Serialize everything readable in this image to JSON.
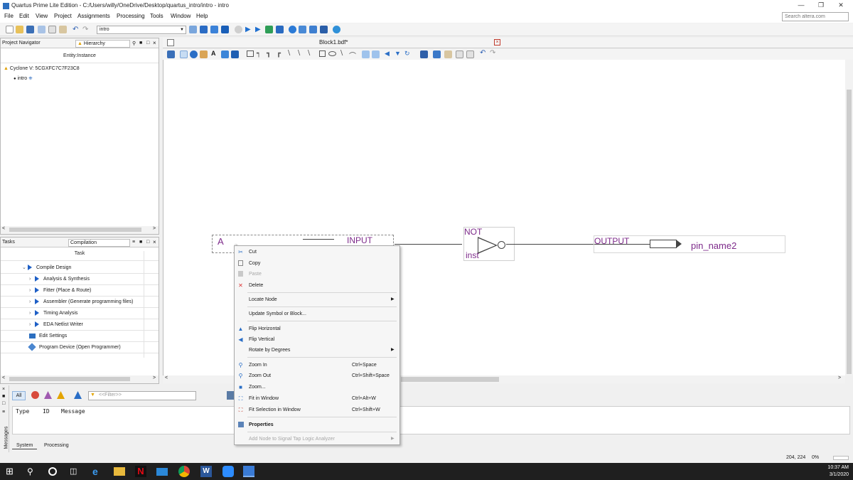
{
  "window": {
    "title": "Quartus Prime Lite Edition - C:/Users/willy/OneDrive/Desktop/quartus_intro/intro - intro",
    "controls": [
      "minimize",
      "restore",
      "close"
    ]
  },
  "menu_bar": [
    "File",
    "Edit",
    "View",
    "Project",
    "Assignments",
    "Processing",
    "Tools",
    "Window",
    "Help"
  ],
  "search": {
    "placeholder": "Search altera.com"
  },
  "toolbar": {
    "revision": "intro"
  },
  "project_navigator": {
    "title": "Project Navigator",
    "view": "Hierarchy",
    "column": "Entity:Instance",
    "device": "Cyclone V: 5CGXFC7C7F23C8",
    "entity": "intro"
  },
  "tasks": {
    "title": "Tasks",
    "flow": "Compilation",
    "column": "Task",
    "items": [
      {
        "label": "Compile Design",
        "indent": 1
      },
      {
        "label": "Analysis & Synthesis",
        "indent": 2
      },
      {
        "label": "Fitter (Place & Route)",
        "indent": 2
      },
      {
        "label": "Assembler (Generate programming files)",
        "indent": 2
      },
      {
        "label": "Timing Analysis",
        "indent": 2
      },
      {
        "label": "EDA Netlist Writer",
        "indent": 2
      },
      {
        "label": "Edit Settings",
        "indent": 0
      },
      {
        "label": "Program Device (Open Programmer)",
        "indent": 0
      }
    ]
  },
  "editor": {
    "tab": "Block1.bdf*",
    "symbols": {
      "input_name": "A",
      "input_type": "INPUT",
      "gate_type": "NOT",
      "gate_instance": "inst",
      "output_type": "OUTPUT",
      "output_name": "pin_name2"
    }
  },
  "context_menu": [
    {
      "label": "Cut",
      "icon": "cut-icon"
    },
    {
      "label": "Copy",
      "icon": "copy-icon"
    },
    {
      "label": "Paste",
      "icon": "paste-icon",
      "disabled": true
    },
    {
      "label": "Delete",
      "icon": "delete-icon"
    },
    {
      "separator": true
    },
    {
      "label": "Locate Node",
      "submenu": true
    },
    {
      "separator": true
    },
    {
      "label": "Update Symbol or Block..."
    },
    {
      "separator": true
    },
    {
      "label": "Flip Horizontal",
      "icon": "flip-horizontal-icon"
    },
    {
      "label": "Flip Vertical",
      "icon": "flip-vertical-icon"
    },
    {
      "label": "Rotate by Degrees",
      "submenu": true
    },
    {
      "separator": true
    },
    {
      "label": "Zoom In",
      "icon": "zoom-in-icon",
      "shortcut": "Ctrl+Space"
    },
    {
      "label": "Zoom Out",
      "icon": "zoom-out-icon",
      "shortcut": "Ctrl+Shift+Space"
    },
    {
      "label": "Zoom...",
      "icon": "zoom-icon"
    },
    {
      "label": "Fit in Window",
      "icon": "fit-window-icon",
      "shortcut": "Ctrl+Alt+W"
    },
    {
      "label": "Fit Selection in Window",
      "icon": "fit-selection-icon",
      "shortcut": "Ctrl+Shift+W"
    },
    {
      "separator": true
    },
    {
      "label": "Properties",
      "icon": "properties-icon",
      "bold": true
    },
    {
      "separator": true
    },
    {
      "label": "Add Node to Signal Tap Logic Analyzer",
      "submenu": true,
      "disabled": true
    }
  ],
  "messages": {
    "filter_all": "All",
    "filter_placeholder": "<<Filter>>",
    "columns": [
      "Type",
      "ID",
      "Message"
    ],
    "side_label": "Messages",
    "tabs": [
      "System",
      "Processing"
    ]
  },
  "status": {
    "coordinates": "204, 224",
    "zoom": "0%"
  },
  "taskbar": {
    "time": "10:37 AM",
    "date": "3/1/2020"
  }
}
